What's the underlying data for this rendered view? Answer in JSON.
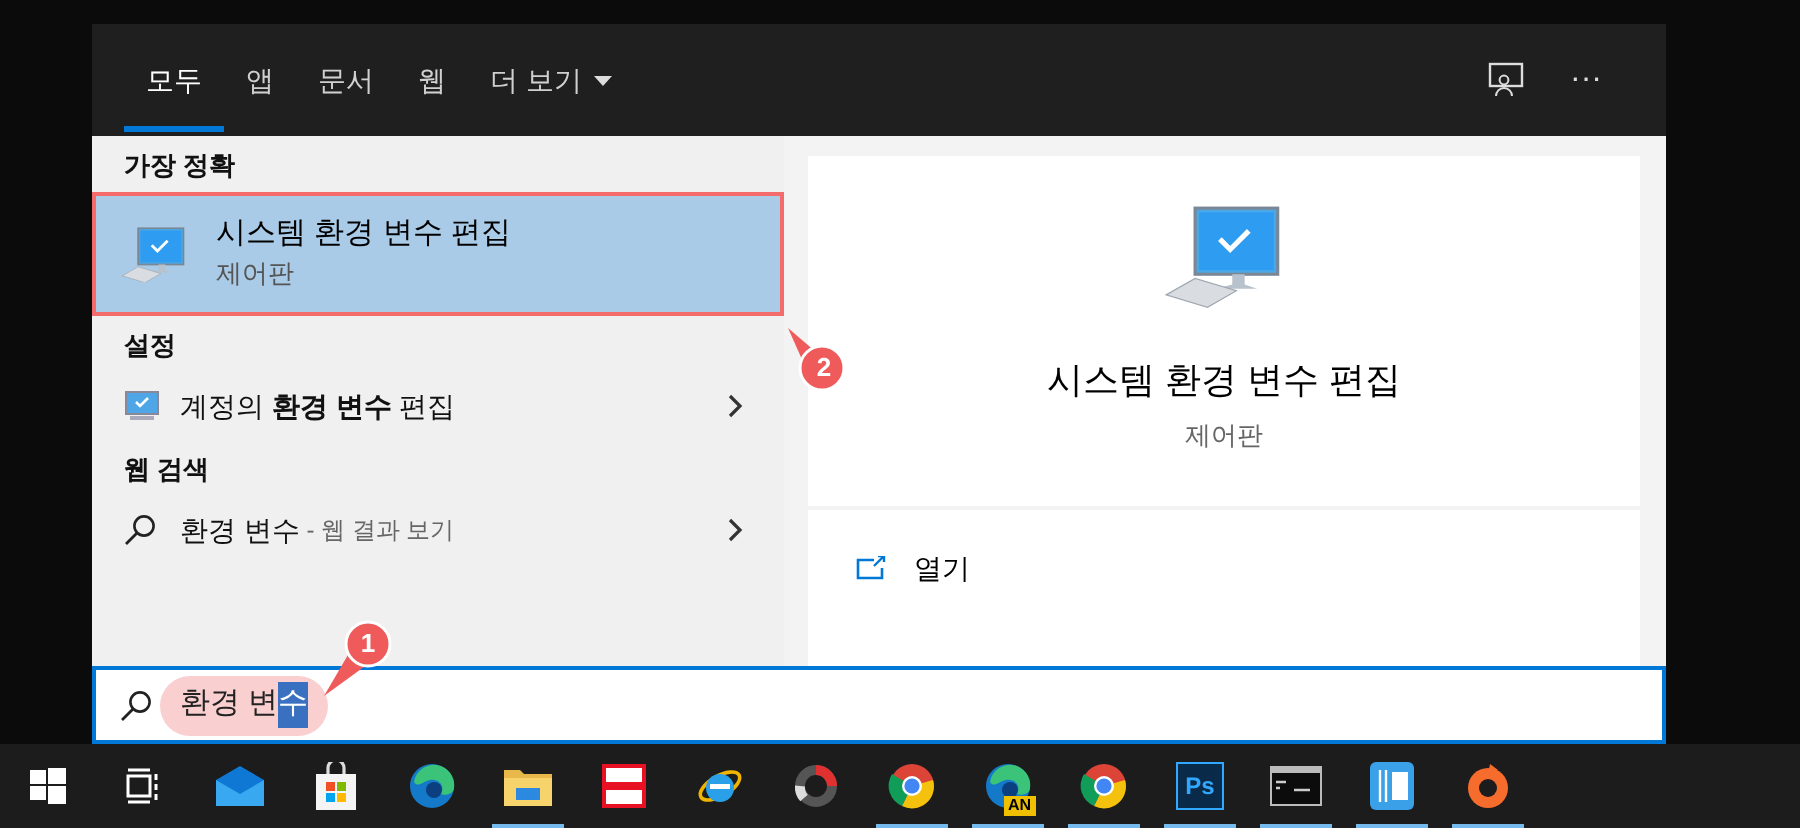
{
  "tabs": [
    {
      "label": "모두",
      "selected": true
    },
    {
      "label": "앱",
      "selected": false
    },
    {
      "label": "문서",
      "selected": false
    },
    {
      "label": "웹",
      "selected": false
    },
    {
      "label": "더 보기",
      "selected": false,
      "dropdown": true
    }
  ],
  "more_button": "···",
  "sections": [
    {
      "header": "가장 정확",
      "items": [
        {
          "kind": "app",
          "title": "시스템 환경 변수 편집",
          "subtitle": "제어판",
          "selected": true,
          "outlined": true,
          "callout": "2"
        }
      ]
    },
    {
      "header": "설정",
      "items": [
        {
          "kind": "setting",
          "title": "계정의 **환경 변수** 편집"
        }
      ]
    },
    {
      "header": "웹 검색",
      "items": [
        {
          "kind": "web",
          "title": "환경 변수",
          "suffix": " - 웹 결과 보기"
        }
      ]
    }
  ],
  "preview": {
    "title": "시스템 환경 변수 편집",
    "subtitle": "제어판",
    "actions": [
      "열기"
    ]
  },
  "search": {
    "highlighted": true,
    "callout": "1",
    "parts": [
      {
        "text": "환경 변",
        "selected": false
      },
      {
        "text": "수",
        "selected": true
      }
    ]
  },
  "taskbar": [
    {
      "kind": "start",
      "running": false
    },
    {
      "kind": "taskview",
      "running": false
    },
    {
      "kind": "mail",
      "running": false
    },
    {
      "kind": "store",
      "running": false
    },
    {
      "kind": "edge",
      "running": false
    },
    {
      "kind": "explorer",
      "running": true
    },
    {
      "kind": "redapp",
      "running": false
    },
    {
      "kind": "ie",
      "running": false
    },
    {
      "kind": "ring",
      "running": false
    },
    {
      "kind": "chrome",
      "running": true
    },
    {
      "kind": "edgebadge",
      "running": true,
      "badge": "AN"
    },
    {
      "kind": "chrome",
      "running": true
    },
    {
      "kind": "ps",
      "running": true,
      "label": "Ps"
    },
    {
      "kind": "terminal",
      "running": true
    },
    {
      "kind": "bluebook",
      "running": true
    },
    {
      "kind": "origin",
      "running": true
    }
  ]
}
